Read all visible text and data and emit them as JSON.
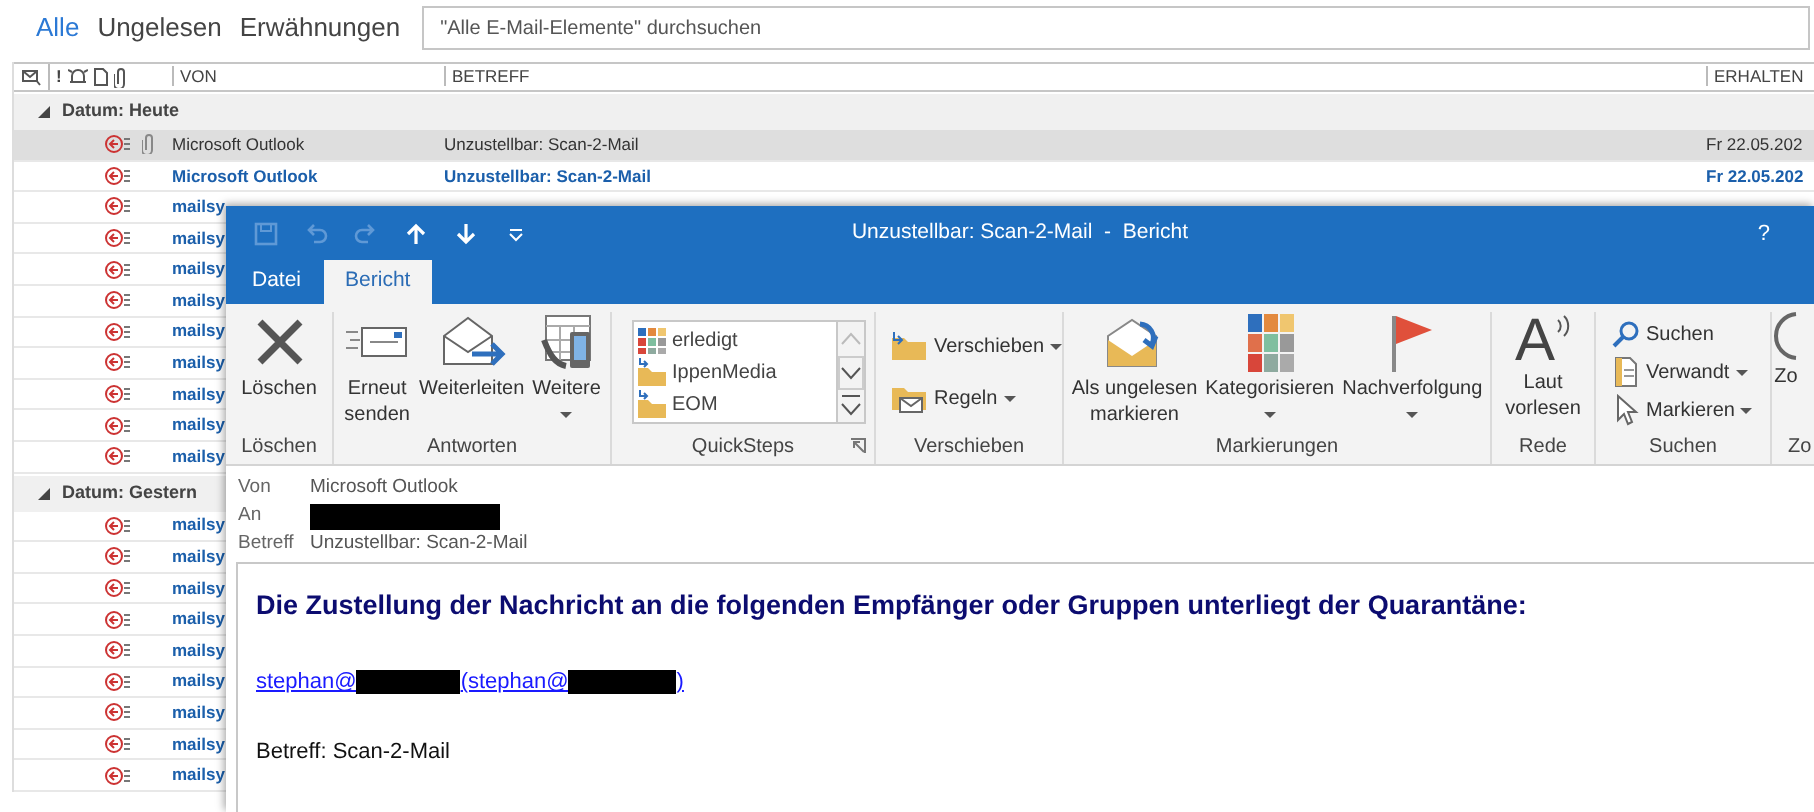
{
  "filter_tabs": [
    {
      "label": "Alle",
      "selected": true
    },
    {
      "label": "Ungelesen",
      "selected": false
    },
    {
      "label": "Erwähnungen",
      "selected": false
    }
  ],
  "search": {
    "placeholder": "\"Alle E-Mail-Elemente\" durchsuchen"
  },
  "columns": {
    "importance": "!",
    "from": "VON",
    "subject": "BETREFF",
    "received": "ERHALTEN"
  },
  "groups": [
    {
      "label": "Datum: Heute",
      "expanded": true,
      "rows": [
        {
          "from": "Microsoft Outlook",
          "subject": "Unzustellbar: Scan-2-Mail",
          "received": "Fr 22.05.202",
          "unread": false,
          "selected": true,
          "attachment": true
        },
        {
          "from": "Microsoft Outlook",
          "subject": "Unzustellbar: Scan-2-Mail",
          "received": "Fr 22.05.202",
          "unread": true,
          "selected": false,
          "attachment": false
        },
        {
          "from": "mailsy",
          "unread": true,
          "selected": false,
          "attachment": false
        },
        {
          "from": "mailsy",
          "unread": true,
          "selected": false,
          "attachment": false
        },
        {
          "from": "mailsy",
          "unread": true,
          "selected": false,
          "attachment": false
        },
        {
          "from": "mailsy",
          "unread": true,
          "selected": false,
          "attachment": false
        },
        {
          "from": "mailsy",
          "unread": true,
          "selected": false,
          "attachment": false
        },
        {
          "from": "mailsy",
          "unread": true,
          "selected": false,
          "attachment": false
        },
        {
          "from": "mailsy",
          "unread": true,
          "selected": false,
          "attachment": false
        },
        {
          "from": "mailsy",
          "unread": true,
          "selected": false,
          "attachment": false
        },
        {
          "from": "mailsy",
          "unread": true,
          "selected": false,
          "attachment": false
        }
      ]
    },
    {
      "label": "Datum: Gestern",
      "expanded": true,
      "rows": [
        {
          "from": "mailsy",
          "unread": true,
          "selected": false,
          "attachment": false
        },
        {
          "from": "mailsy",
          "unread": true,
          "selected": false,
          "attachment": false
        },
        {
          "from": "mailsy",
          "unread": true,
          "selected": false,
          "attachment": false
        },
        {
          "from": "mailsy",
          "unread": true,
          "selected": false,
          "attachment": false
        },
        {
          "from": "mailsy",
          "unread": true,
          "selected": false,
          "attachment": false
        },
        {
          "from": "mailsy",
          "unread": true,
          "selected": false,
          "attachment": false
        },
        {
          "from": "mailsy",
          "unread": true,
          "selected": false,
          "attachment": false
        },
        {
          "from": "mailsy",
          "unread": true,
          "selected": false,
          "attachment": false
        },
        {
          "from": "mailsy",
          "unread": true,
          "selected": false,
          "attachment": false
        }
      ]
    }
  ],
  "message_window": {
    "title": "Unzustellbar: Scan-2-Mail  -  Bericht",
    "help": "?",
    "quick_access": [
      {
        "disabled": true
      },
      {
        "disabled": true
      },
      {
        "disabled": true
      },
      {
        "disabled": false
      },
      {
        "disabled": false
      },
      {
        "disabled": false
      }
    ],
    "tabs": [
      {
        "label": "Datei",
        "selected": false
      },
      {
        "label": "Bericht",
        "selected": true
      }
    ],
    "ribbon": [
      {
        "label": "Löschen",
        "kind": "large",
        "items": [
          {
            "label": "Löschen"
          }
        ]
      },
      {
        "label": "Antworten",
        "kind": "large",
        "items": [
          {
            "label": "Erneut senden"
          },
          {
            "label": "Weiterleiten"
          },
          {
            "label": "Weitere",
            "dropdown": true
          }
        ]
      },
      {
        "label": "QuickSteps",
        "kind": "gallery",
        "items": [
          {
            "label": "erledigt"
          },
          {
            "label": "IppenMedia"
          },
          {
            "label": "EOM"
          }
        ]
      },
      {
        "label": "Verschieben",
        "kind": "small",
        "items": [
          {
            "label": "Verschieben",
            "dropdown": true
          },
          {
            "label": "Regeln",
            "dropdown": true
          }
        ]
      },
      {
        "label": "Markierungen",
        "kind": "large",
        "items": [
          {
            "label": "Als ungelesen markieren"
          },
          {
            "label": "Kategorisieren",
            "dropdown": true
          },
          {
            "label": "Nachverfolgung",
            "dropdown": true
          }
        ]
      },
      {
        "label": "Rede",
        "kind": "large",
        "items": [
          {
            "label": "Laut vorlesen",
            "glyph": "A"
          }
        ]
      },
      {
        "label": "Suchen",
        "kind": "small",
        "items": [
          {
            "label": "Suchen"
          },
          {
            "label": "Verwandt",
            "dropdown": true
          },
          {
            "label": "Markieren",
            "dropdown": true
          }
        ]
      },
      {
        "label": "Zo",
        "kind": "large",
        "items": [
          {
            "label": "Zo"
          }
        ]
      }
    ],
    "headers": [
      {
        "label": "Von",
        "value": "Microsoft Outlook"
      },
      {
        "label": "An",
        "redacted": true
      },
      {
        "label": "Betreff",
        "value": "Unzustellbar: Scan-2-Mail"
      }
    ],
    "body": {
      "heading": "Die Zustellung der Nachricht an die folgenden Empfänger oder Gruppen unterliegt der Quarantäne:",
      "link_parts": [
        {
          "kind": "text",
          "text": "stephan@"
        },
        {
          "kind": "redacted"
        },
        {
          "kind": "text",
          "text": "(stephan@"
        },
        {
          "kind": "redacted"
        },
        {
          "kind": "text",
          "text": ")"
        }
      ],
      "subject_line": "Betreff: Scan-2-Mail"
    }
  }
}
